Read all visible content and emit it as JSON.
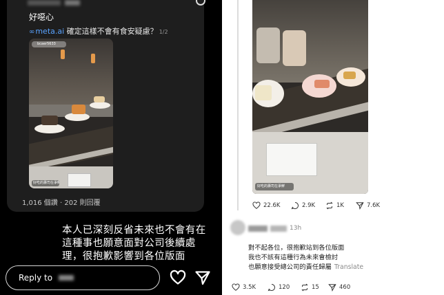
{
  "left_panel": {
    "post": {
      "title": "好噁心",
      "meta_icon": "∞",
      "meta_link": "meta.ai",
      "meta_question": " 確定這樣不會有食安疑慮？",
      "meta_page": "1/2",
      "video_profile": "bcaer5633",
      "video_tag": "好吃的壽司在爭鮮",
      "replies_count": "1,016 個讚 · 202 則回覆"
    },
    "caption": "本人已深刻反省未來也不會有在這種事也願意面對公司後續處理，很抱歉影響到各位版面",
    "reply_bar": {
      "label": "Reply to"
    },
    "icons": {
      "heart": "heart-outline-icon",
      "send": "send-icon",
      "corner": "bookmark-corner-icon"
    }
  },
  "right_panel": {
    "video_tag": "好吃的壽司在爭鮮",
    "stats": {
      "likes": "22.6K",
      "comments": "2.9K",
      "reposts": "1K",
      "shares": "7.6K"
    },
    "comment": {
      "time": "13h",
      "lines": [
        "對不起各位，很抱歉站到各位版面",
        "我也不該有這種行為未來會檢討",
        "也願意接受總公司的責任歸屬"
      ],
      "translate": "Translate"
    },
    "comment_stats": {
      "likes": "3.5K",
      "comments": "120",
      "reposts": "15",
      "shares": "460"
    }
  },
  "colors": {
    "left_bg": "#000000",
    "card_bg": "#1e1e1e",
    "link_blue": "#5aa3ff",
    "right_bg": "#ffffff"
  }
}
